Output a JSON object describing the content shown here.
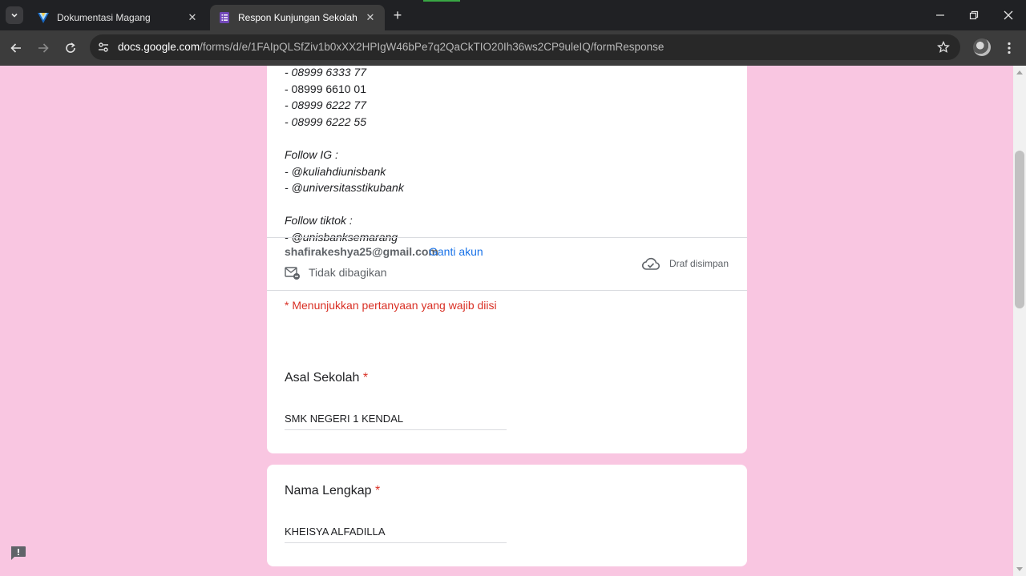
{
  "browser": {
    "tabs": [
      {
        "title": "Dokumentasi Magang",
        "active": false,
        "icon": "vuetify-logo-icon"
      },
      {
        "title": "Respon Kunjungan Sekolah",
        "active": true,
        "icon": "google-forms-icon"
      }
    ],
    "url_host": "docs.google.com",
    "url_path": "/forms/d/e/1FAIpQLSfZiv1b0xXX2HPIgW46bPe7q2QaCkTIO20Ih36ws2CP9uleIQ/formResponse"
  },
  "form": {
    "description_lines": [
      {
        "text": "- 08999 6333 77",
        "italic": true
      },
      {
        "text": "- 08999 6610 01",
        "italic": false
      },
      {
        "text": "- 08999 6222 77",
        "italic": true
      },
      {
        "text": "- 08999 6222 55",
        "italic": true
      },
      {
        "text": "",
        "italic": true
      },
      {
        "text": "Follow IG :",
        "italic": true
      },
      {
        "text": "- @kuliahdiunisbank",
        "italic": true
      },
      {
        "text": "- @universitasstikubank",
        "italic": true
      },
      {
        "text": "",
        "italic": true
      },
      {
        "text": "Follow tiktok :",
        "italic": true
      },
      {
        "text": "- @unisbanksemarang",
        "italic": true
      }
    ],
    "account": {
      "email": "shafirakeshya25@gmail.com",
      "switch_label": "Ganti akun",
      "not_shared": "Tidak dibagikan",
      "draft_status": "Draf disimpan"
    },
    "required_note": "* Menunjukkan pertanyaan yang wajib diisi",
    "questions": [
      {
        "title": "Asal Sekolah",
        "required_mark": "*",
        "value": "SMK NEGERI 1 KENDAL"
      },
      {
        "title": "Nama Lengkap",
        "required_mark": "*",
        "value": "KHEISYA ALFADILLA"
      }
    ]
  },
  "colors": {
    "page_background": "#f9c6e1",
    "required_red": "#d93025",
    "link_blue": "#1a73e8"
  }
}
